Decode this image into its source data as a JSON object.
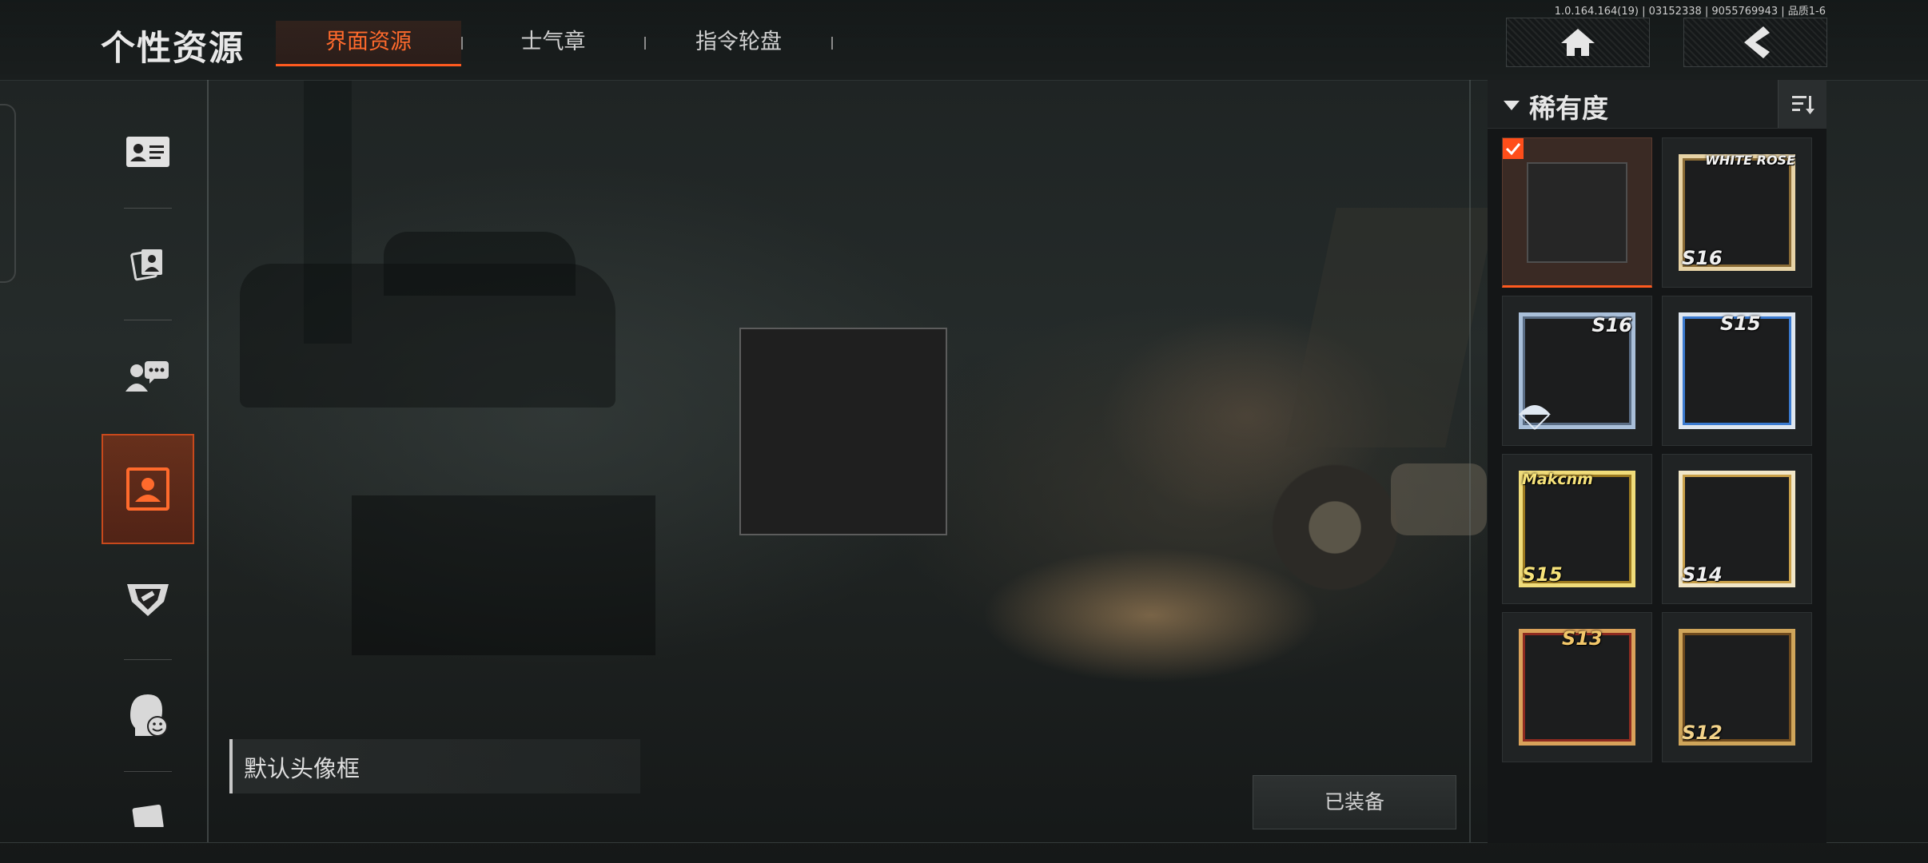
{
  "version_info": "1.0.164.164(19) | 03152338 | 9055769943 | 品质1-6",
  "header": {
    "title": "个性资源",
    "tabs": [
      {
        "label": "界面资源",
        "active": true
      },
      {
        "label": "士气章",
        "active": false
      },
      {
        "label": "指令轮盘",
        "active": false
      }
    ],
    "home_icon": "home-icon",
    "back_icon": "back-chevron-icon"
  },
  "sidebar": {
    "items": [
      {
        "icon": "id-card-icon",
        "active": false
      },
      {
        "icon": "photo-cards-icon",
        "active": false
      },
      {
        "icon": "chat-user-icon",
        "active": false
      },
      {
        "icon": "avatar-frame-icon",
        "active": true
      },
      {
        "icon": "badge-emblem-icon",
        "active": false
      },
      {
        "icon": "face-emoji-icon",
        "active": false
      },
      {
        "icon": "card-partial-icon",
        "active": false
      }
    ]
  },
  "preview": {
    "item_name": "默认头像框",
    "equip_status": "已装备"
  },
  "filter": {
    "label": "稀有度",
    "sort_icon": "sort-icon"
  },
  "grid": [
    {
      "season": "",
      "style": "default",
      "selected": true,
      "tag": ""
    },
    {
      "season": "S16",
      "style": "gold-white",
      "selected": false,
      "tag": "WHITE ROSE"
    },
    {
      "season": "S16",
      "style": "silver-blue",
      "selected": false,
      "tag": ""
    },
    {
      "season": "S15",
      "style": "blue-white",
      "selected": false,
      "tag": ""
    },
    {
      "season": "S15",
      "style": "gold-yellow",
      "selected": false,
      "tag": "Makcnm"
    },
    {
      "season": "S14",
      "style": "gold-white",
      "selected": false,
      "tag": ""
    },
    {
      "season": "S13",
      "style": "red-gold",
      "selected": false,
      "tag": ""
    },
    {
      "season": "S12",
      "style": "brown-gold",
      "selected": false,
      "tag": ""
    }
  ],
  "colors": {
    "accent": "#ff5a1f",
    "active_tab_text": "#ff6a2c",
    "panel_bg": "#141617"
  }
}
